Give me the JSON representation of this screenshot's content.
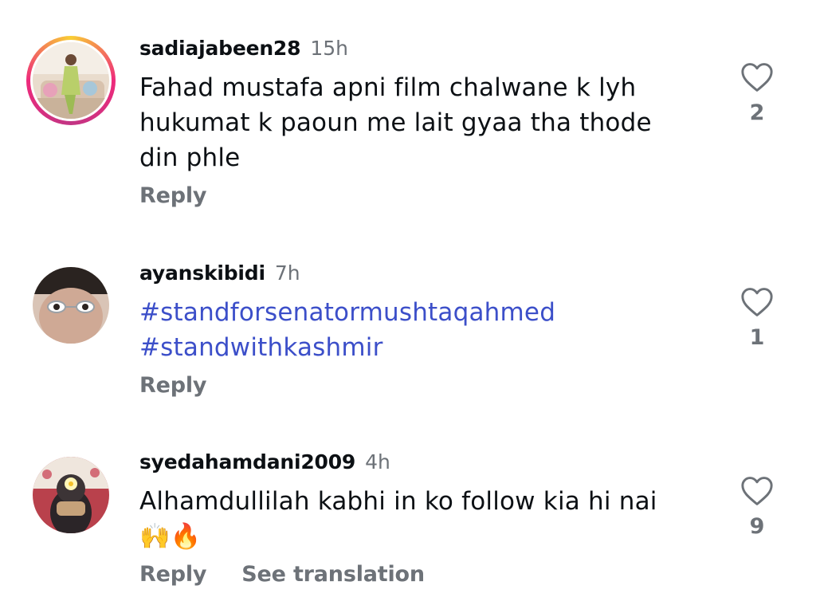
{
  "comments": [
    {
      "username": "sadiajabeen28",
      "time": "15h",
      "text_lines": [
        "Fahad mustafa apni film chalwane k lyh",
        "hukumat k paoun me lait gyaa tha thode",
        "din phle"
      ],
      "reply_label": "Reply",
      "like_count": "2",
      "avatar_icon": "profile-photo-woman-sofa",
      "story_ring": true
    },
    {
      "username": "ayanskibidi",
      "time": "7h",
      "text_lines": [
        "#standforsenatormushtaqahmed",
        "#standwithkashmir"
      ],
      "reply_label": "Reply",
      "like_count": "1",
      "avatar_icon": "profile-photo-face-glasses",
      "story_ring": false
    },
    {
      "username": "syedahamdani2009",
      "time": "4h",
      "text_lines": [
        "Alhamdullilah kabhi in ko follow kia hi nai",
        "🙌🔥"
      ],
      "reply_label": "Reply",
      "translate_label": "See translation",
      "like_count": "9",
      "avatar_icon": "profile-photo-person-flowers",
      "story_ring": false
    }
  ],
  "colors": {
    "username": "#0c1014",
    "secondary": "#6d7278",
    "hashtag": "#3c4fc9"
  }
}
